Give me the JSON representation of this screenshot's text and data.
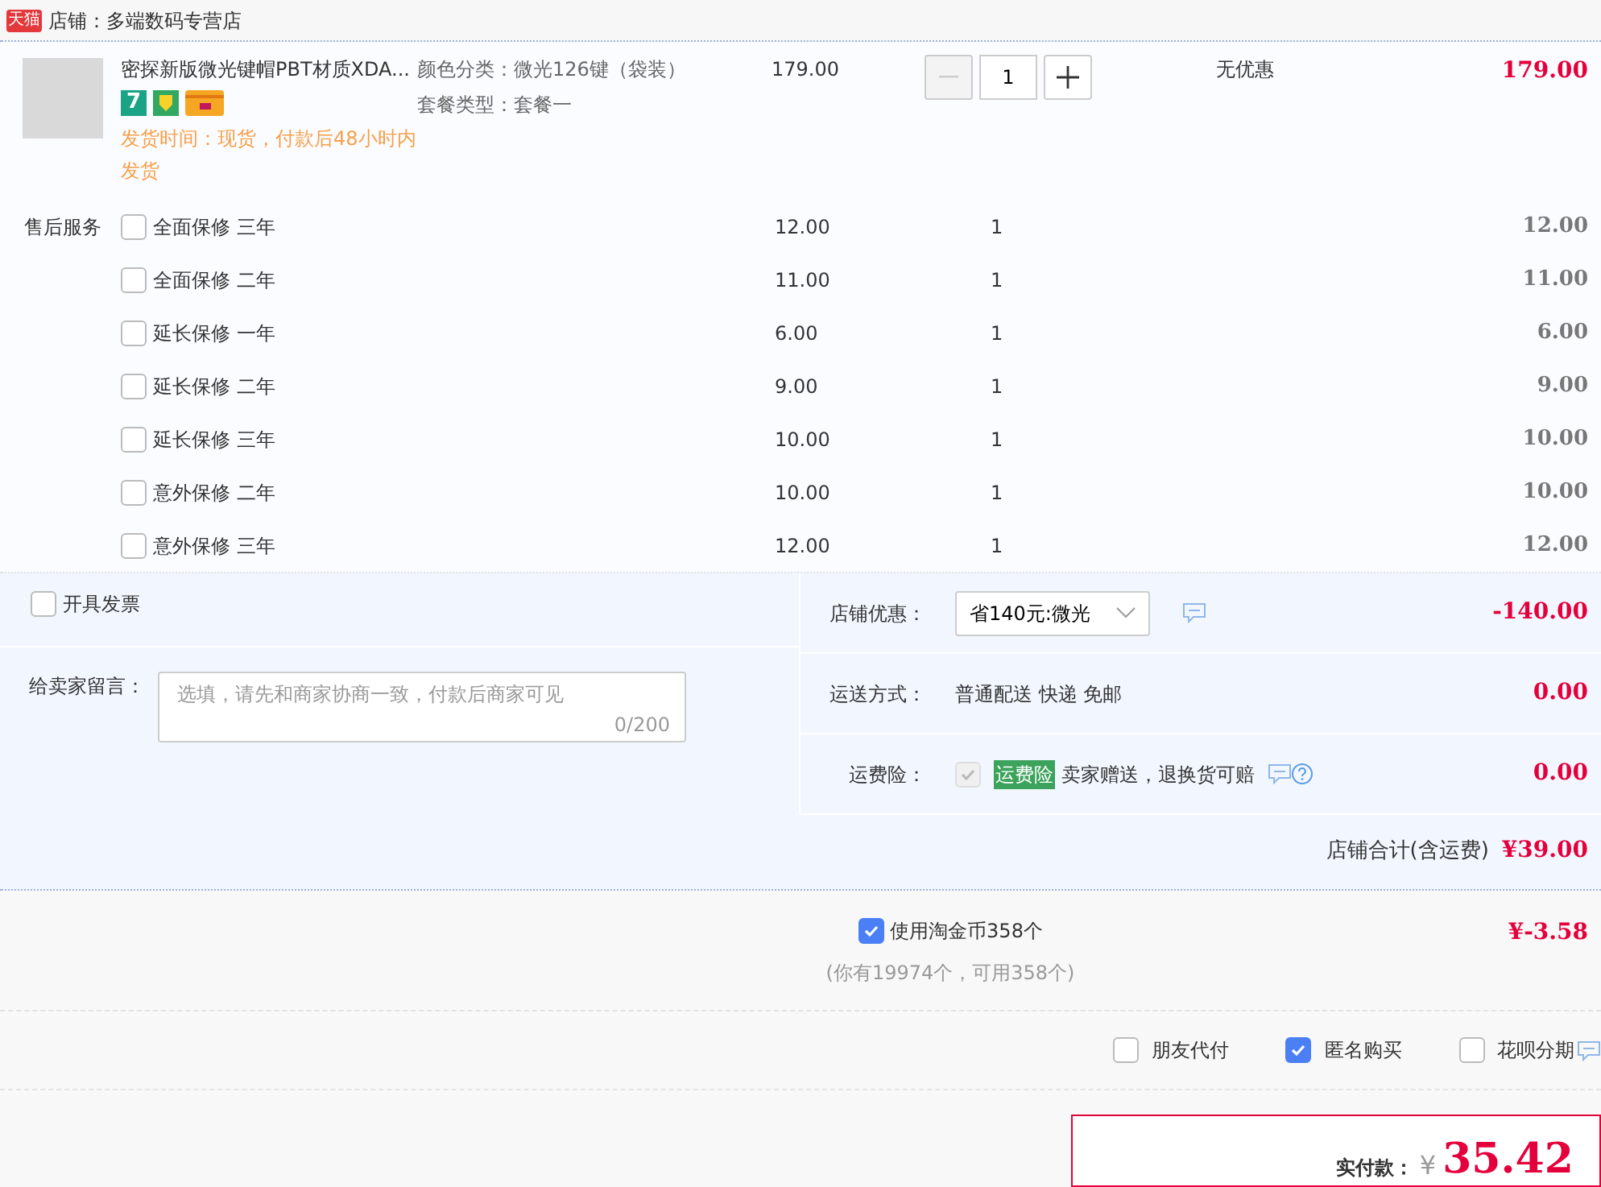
{
  "shop": {
    "logo": "天猫",
    "name": "店铺：多端数码专营店"
  },
  "item": {
    "title": "密探新版微光键帽PBT材质XDA...",
    "seven_day_badge": "7",
    "delivery": "发货时间：现货，付款后48小时内发货",
    "specs": [
      {
        "label": "颜色分类：",
        "value": "微光126键（袋装）"
      },
      {
        "label": "套餐类型：",
        "value": "套餐一"
      }
    ],
    "price": "179.00",
    "quantity": "1",
    "decrease_disabled": true,
    "discount": "无优惠",
    "total": "179.00"
  },
  "services": {
    "label": "售后服务",
    "rows": [
      {
        "name": "全面保修 三年",
        "checked": false,
        "price": "12.00",
        "quantity": "1",
        "total": "12.00"
      },
      {
        "name": "全面保修 二年",
        "checked": false,
        "price": "11.00",
        "quantity": "1",
        "total": "11.00"
      },
      {
        "name": "延长保修 一年",
        "checked": false,
        "price": "6.00",
        "quantity": "1",
        "total": "6.00"
      },
      {
        "name": "延长保修 二年",
        "checked": false,
        "price": "9.00",
        "quantity": "1",
        "total": "9.00"
      },
      {
        "name": "延长保修 三年",
        "checked": false,
        "price": "10.00",
        "quantity": "1",
        "total": "10.00"
      },
      {
        "name": "意外保修 二年",
        "checked": false,
        "price": "10.00",
        "quantity": "1",
        "total": "10.00"
      },
      {
        "name": "意外保修 三年",
        "checked": false,
        "price": "12.00",
        "quantity": "1",
        "total": "12.00"
      }
    ]
  },
  "invoice": {
    "label": "开具发票",
    "checked": false
  },
  "message": {
    "label": "给卖家留言：",
    "placeholder": "选填，请先和商家协商一致，付款后商家可见",
    "counter": "0/200"
  },
  "store_discount": {
    "label": "店铺优惠：",
    "selection": "省140元:微光",
    "amount": "-140.00"
  },
  "shipping": {
    "label": "运送方式：",
    "method": "普通配送 快递 免邮",
    "amount": "0.00"
  },
  "freight_insurance": {
    "label": "运费险：",
    "checked": true,
    "disabled": true,
    "tag": "运费险",
    "text": "卖家赠送，退换货可赔",
    "amount": "0.00"
  },
  "store_total": {
    "label": "店铺合计(含运费)",
    "amount": "¥39.00"
  },
  "coins": {
    "label": "使用淘金币358个",
    "checked": true,
    "note": "(你有19974个，可用358个)",
    "amount": "¥-3.58"
  },
  "options": [
    {
      "label": "朋友代付",
      "checked": false
    },
    {
      "label": "匿名购买",
      "checked": true
    },
    {
      "label": "花呗分期",
      "checked": false
    }
  ],
  "payment": {
    "label": "实付款：",
    "currency": "¥",
    "amount": "35.42"
  }
}
